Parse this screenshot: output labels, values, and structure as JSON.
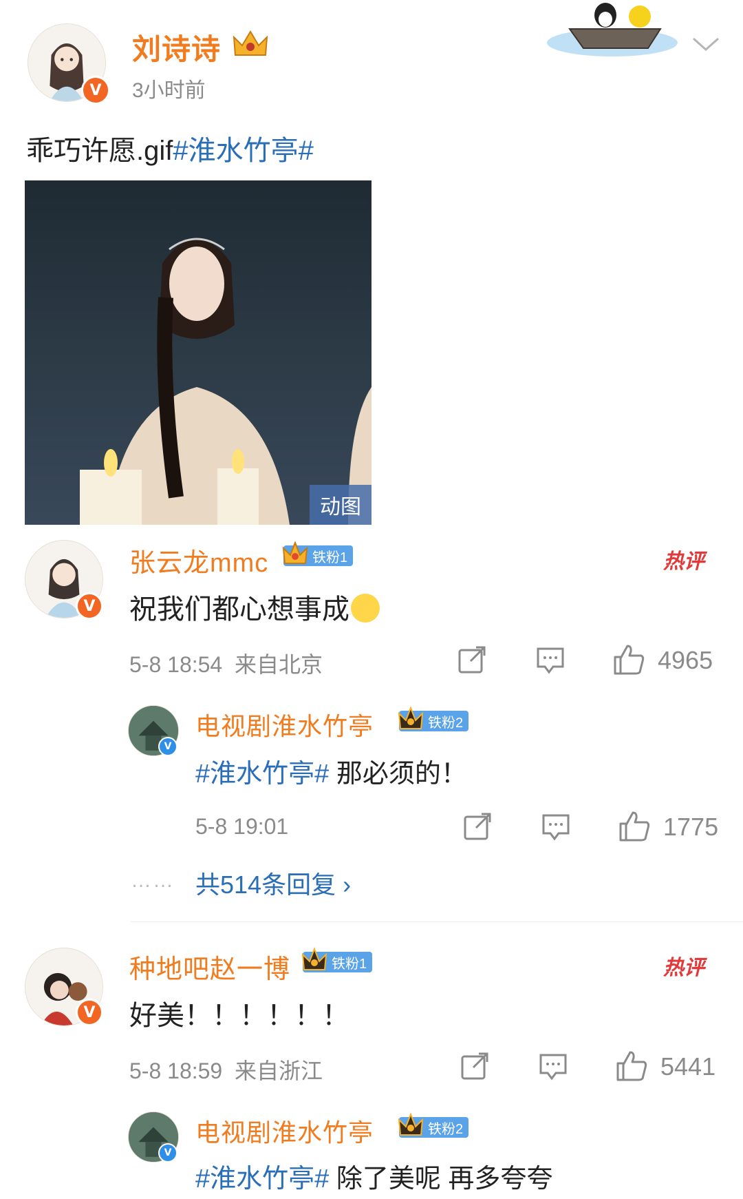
{
  "post": {
    "author": "刘诗诗",
    "time": "3小时前",
    "text_plain": "乖巧许愿.gif",
    "text_hashtag": "#淮水竹亭#",
    "media_badge": "动图"
  },
  "comments": [
    {
      "author": "张云龙mmc",
      "fan_badge": "铁粉1",
      "hot_label": "热评",
      "text": "祝我们都心想事成",
      "date": "5-8 18:54",
      "location": "来自北京",
      "likes": "4965",
      "reply": {
        "author": "电视剧淮水竹亭",
        "fan_badge": "铁粉2",
        "hashtag": "#淮水竹亭#",
        "text": "那必须的！",
        "date": "5-8 19:01",
        "likes": "1775"
      },
      "more_dots": "……",
      "more_replies": "共514条回复 ›"
    },
    {
      "author": "种地吧赵一博",
      "fan_badge": "铁粉1",
      "hot_label": "热评",
      "text": "好美！！！！！！",
      "date": "5-8 18:59",
      "location": "来自浙江",
      "likes": "5441",
      "reply": {
        "author": "电视剧淮水竹亭",
        "fan_badge": "铁粉2",
        "hashtag": "#淮水竹亭#",
        "text": "除了美呢 再多夸夸"
      }
    }
  ],
  "colors": {
    "name_orange": "#f07c1f",
    "hashtag_blue": "#2a6eb8",
    "meta_gray": "#8a8a8a",
    "badge_blue": "#5aa3e8",
    "hot_red": "#e13a3a"
  },
  "icons": [
    "chevron-down-icon",
    "share-icon",
    "comment-icon",
    "like-icon",
    "crown-icon",
    "verified-icon"
  ]
}
